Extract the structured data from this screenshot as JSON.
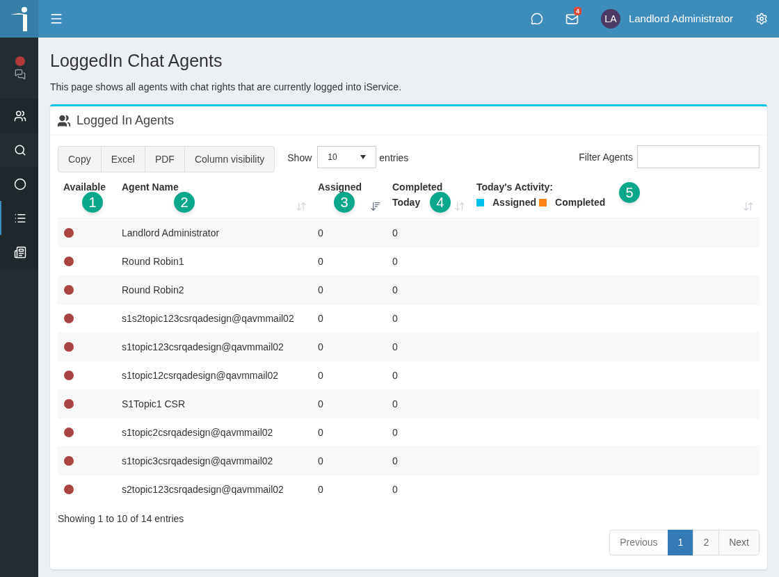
{
  "topbar": {
    "mail_badge": "4",
    "user_initials": "LA",
    "user_name": "Landlord Administrator"
  },
  "sidebar": {
    "items": [
      {
        "kind": "status",
        "selected": false
      },
      {
        "kind": "users",
        "selected": false
      },
      {
        "kind": "search",
        "selected": false
      },
      {
        "kind": "circle",
        "selected": false
      },
      {
        "kind": "list",
        "selected": true
      },
      {
        "kind": "card",
        "selected": false
      }
    ]
  },
  "page": {
    "title": "LoggedIn Chat Agents",
    "description": "This page shows all agents with chat rights that are currently logged into iService."
  },
  "panel": {
    "title": "Logged In Agents",
    "buttons": [
      "Copy",
      "Excel",
      "PDF",
      "Column visibility"
    ],
    "length": {
      "label_before": "Show",
      "value": "10",
      "label_after": "entries"
    },
    "filter": {
      "label": "Filter Agents"
    },
    "columns": [
      {
        "lines": [
          "Available"
        ],
        "sortable": false
      },
      {
        "lines": [
          "Agent Name"
        ],
        "sortable": true,
        "sorted": false
      },
      {
        "lines": [
          "Assigned"
        ],
        "sortable": true,
        "sorted": true
      },
      {
        "lines": [
          "Completed",
          "Today"
        ],
        "sortable": true,
        "sorted": false
      },
      {
        "lines": [
          "Today's Activity:"
        ],
        "sortable": true,
        "sorted": false,
        "legend": [
          {
            "label": "Assigned",
            "color": "#00c0ef"
          },
          {
            "label": "Completed",
            "color": "#ff851b"
          }
        ]
      }
    ],
    "rows": [
      {
        "available": false,
        "name": "Landlord Administrator",
        "assigned": "0",
        "completed": "0"
      },
      {
        "available": false,
        "name": "Round Robin1",
        "assigned": "0",
        "completed": "0"
      },
      {
        "available": false,
        "name": "Round Robin2",
        "assigned": "0",
        "completed": "0"
      },
      {
        "available": false,
        "name": "s1s2topic123csrqadesign@qavmmail02",
        "assigned": "0",
        "completed": "0"
      },
      {
        "available": false,
        "name": "s1topic123csrqadesign@qavmmail02",
        "assigned": "0",
        "completed": "0"
      },
      {
        "available": false,
        "name": "s1topic12csrqadesign@qavmmail02",
        "assigned": "0",
        "completed": "0"
      },
      {
        "available": false,
        "name": "S1Topic1 CSR",
        "assigned": "0",
        "completed": "0"
      },
      {
        "available": false,
        "name": "s1topic2csrqadesign@qavmmail02",
        "assigned": "0",
        "completed": "0"
      },
      {
        "available": false,
        "name": "s1topic3csrqadesign@qavmmail02",
        "assigned": "0",
        "completed": "0"
      },
      {
        "available": false,
        "name": "s2topic123csrqadesign@qavmmail02",
        "assigned": "0",
        "completed": "0"
      }
    ],
    "info": "Showing 1 to 10 of 14 entries",
    "pagination": [
      {
        "label": "Previous",
        "kind": "prev",
        "selected": false
      },
      {
        "label": "1",
        "kind": "page",
        "selected": true
      },
      {
        "label": "2",
        "kind": "page",
        "selected": false
      },
      {
        "label": "Next",
        "kind": "next",
        "selected": false
      }
    ]
  },
  "callouts": [
    "1",
    "2",
    "3",
    "4",
    "5"
  ]
}
